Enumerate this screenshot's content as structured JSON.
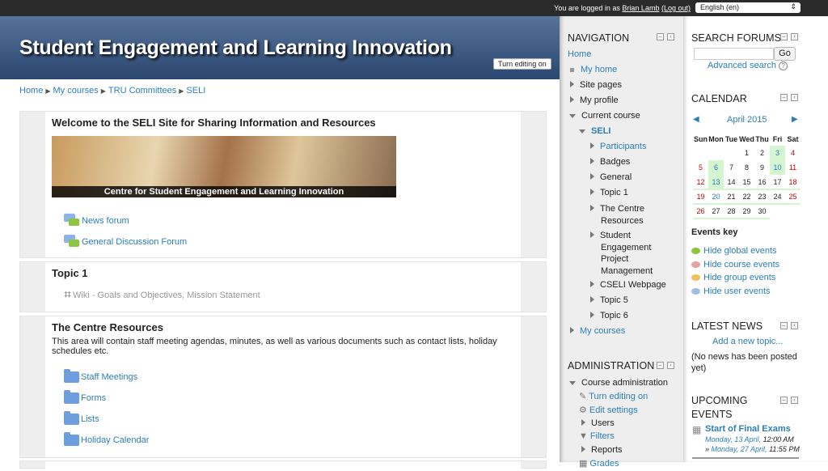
{
  "topbar": {
    "logged_in_prefix": "You are logged in as",
    "user": "Brian Lamb",
    "logout": "(Log out)",
    "language": "English (en)"
  },
  "header": {
    "title": "Student Engagement and Learning Innovation",
    "edit_button": "Turn editing on"
  },
  "breadcrumb": [
    "Home",
    "My courses",
    "TRU Committees",
    "SELI"
  ],
  "sections": {
    "welcome": {
      "title": "Welcome to the SELI Site for Sharing Information and Resources",
      "banner_caption": "Centre for Student Engagement and Learning Innovation",
      "activities": [
        "News forum",
        "General Discussion Forum"
      ]
    },
    "topic1": {
      "title": "Topic 1",
      "activities": [
        "Wiki - Goals and Objectives, Mission Statement"
      ]
    },
    "resources": {
      "title": "The Centre Resources",
      "summary": "This area will contain staff meeting agendas, minutes, as well as various documents such as contact lists, holiday schedules etc.",
      "folders": [
        "Staff Meetings",
        "Forms",
        "Lists",
        "Holiday Calendar"
      ]
    }
  },
  "navigation": {
    "title": "NAVIGATION",
    "home": "Home",
    "items": [
      "My home",
      "Site pages",
      "My profile",
      "Current course",
      "SELI",
      "Participants",
      "Badges",
      "General",
      "Topic 1",
      "The Centre Resources",
      "Student Engagement Project Management",
      "CSELI Webpage",
      "Topic 5",
      "Topic 6",
      "My courses"
    ]
  },
  "administration": {
    "title": "ADMINISTRATION",
    "items": [
      "Course administration",
      "Turn editing on",
      "Edit settings",
      "Users",
      "Filters",
      "Reports",
      "Grades"
    ]
  },
  "search_forums": {
    "title": "SEARCH FORUMS",
    "go": "Go",
    "advanced": "Advanced search",
    "input_value": ""
  },
  "calendar": {
    "title": "CALENDAR",
    "month": "April 2015",
    "days": [
      "Sun",
      "Mon",
      "Tue",
      "Wed",
      "Thu",
      "Fri",
      "Sat"
    ],
    "weeks": [
      [
        "",
        "",
        "",
        "1",
        "2",
        "3",
        "4"
      ],
      [
        "5",
        "6",
        "7",
        "8",
        "9",
        "10",
        "11"
      ],
      [
        "12",
        "13",
        "14",
        "15",
        "16",
        "17",
        "18"
      ],
      [
        "19",
        "20",
        "21",
        "22",
        "23",
        "24",
        "25"
      ],
      [
        "26",
        "27",
        "28",
        "29",
        "30",
        "",
        ""
      ]
    ],
    "events_key": "Events key",
    "key_items": [
      "Hide global events",
      "Hide course events",
      "Hide group events",
      "Hide user events"
    ],
    "key_colors": [
      "#8cc63f",
      "#e6a0a0",
      "#f0c060",
      "#a0c0e0"
    ]
  },
  "latest_news": {
    "title": "LATEST NEWS",
    "add": "Add a new topic...",
    "empty": "(No news has been posted yet)"
  },
  "upcoming": {
    "title": "UPCOMING EVENTS",
    "event": "Start of Final Exams",
    "start_date": "Monday, 13 April,",
    "start_time": "12:00 AM",
    "end_date": "Monday, 27 April,",
    "end_time": "11:55 PM"
  }
}
